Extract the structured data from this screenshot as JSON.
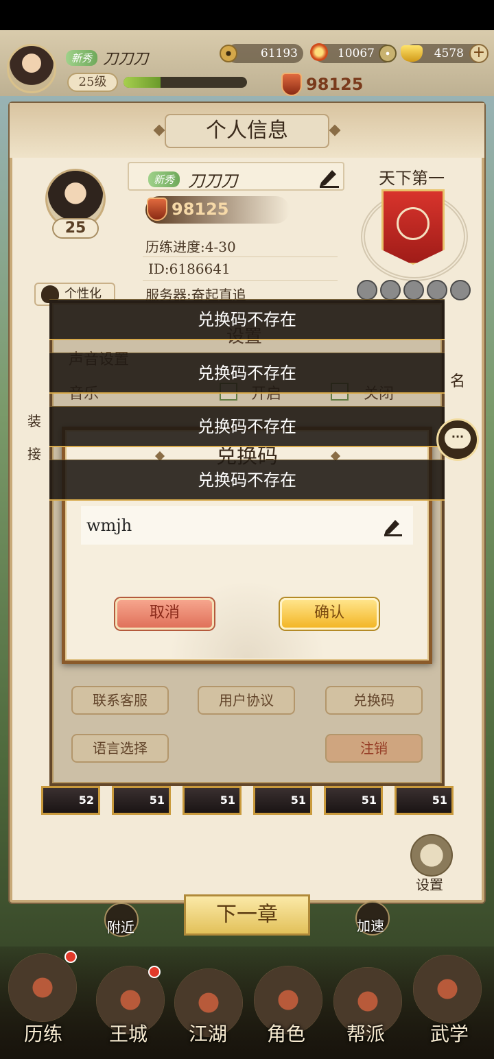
{
  "topbar": {
    "player_tag": "新秀",
    "player_name": "刀刀刀",
    "level": "25级",
    "xp_fraction": 0.3,
    "copper": "61193",
    "gems": "10067",
    "gold": "4578",
    "power": "98125"
  },
  "profile": {
    "title": "个人信息",
    "tag": "新秀",
    "name": "刀刀刀",
    "level": "25",
    "power": "98125",
    "progress": "历练进度:4-30",
    "id": "ID:6186641",
    "server": "服务器:奋起直追",
    "custom_button": "个性化",
    "rank_title": "天下第一"
  },
  "settings": {
    "title": "设置",
    "sound_label": "声音设置",
    "music_label": "音乐",
    "on_label": "开启",
    "off_label": "关闭",
    "side_label_1": "装",
    "side_label_2": "接",
    "right_partial": "名",
    "buttons": {
      "support": "联系客服",
      "agreement": "用户协议",
      "redeem": "兑换码",
      "language": "语言选择",
      "logout": "注销"
    }
  },
  "character_levels": [
    "52",
    "51",
    "51",
    "51",
    "51",
    "51"
  ],
  "redeem_dialog": {
    "title": "兑换码",
    "input_value": "wmjh",
    "cancel": "取消",
    "confirm": "确认"
  },
  "toasts": [
    "兑换码不存在",
    "兑换码不存在",
    "兑换码不存在",
    "兑换码不存在"
  ],
  "chat": {
    "icon": "···"
  },
  "bottom": {
    "settings_label": "设置",
    "next_chapter": "下一章",
    "nearby": "附近",
    "speedup": "加速",
    "nav": [
      "历练",
      "王城",
      "江湖",
      "角色",
      "帮派",
      "武学"
    ]
  },
  "colors": {
    "accent_gold": "#d7a94a",
    "toast_bg": "#1e1812",
    "cancel_red": "#e0715a",
    "confirm_yellow": "#f3b626"
  }
}
